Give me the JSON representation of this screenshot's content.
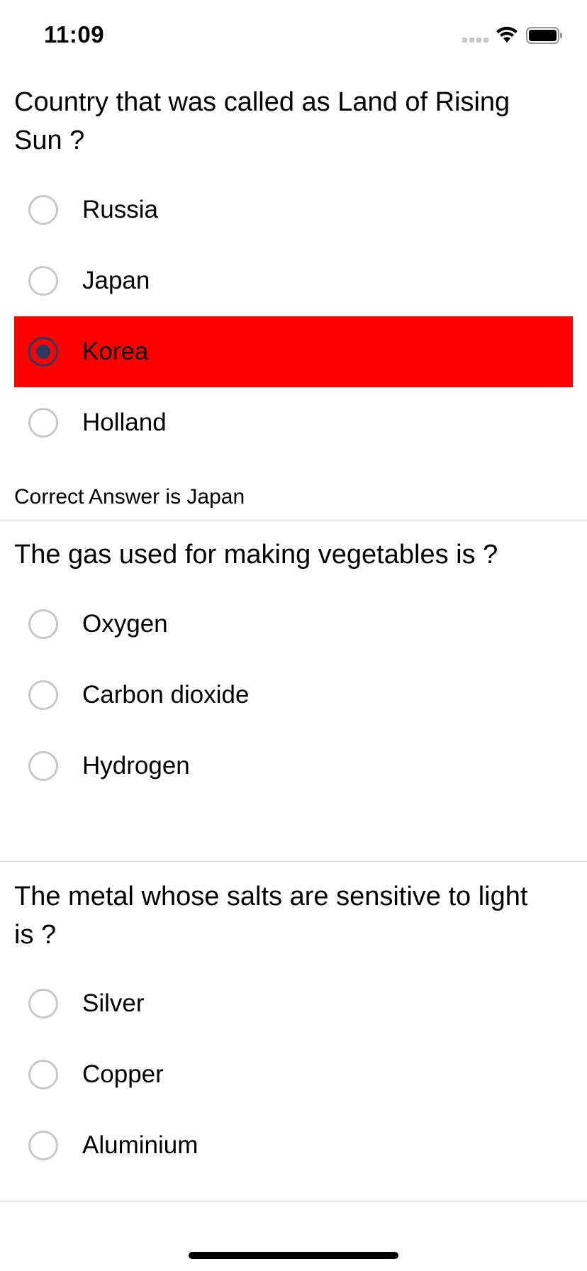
{
  "status_bar": {
    "time": "11:09",
    "icons": [
      "signal-dots-icon",
      "wifi-icon",
      "battery-icon"
    ]
  },
  "questions": [
    {
      "text": "Country that was called as Land of Rising Sun ?",
      "options": [
        {
          "label": "Russia",
          "selected": false
        },
        {
          "label": "Japan",
          "selected": false
        },
        {
          "label": "Korea",
          "selected": true,
          "highlight": "#ff0000"
        },
        {
          "label": "Holland",
          "selected": false
        }
      ],
      "answer_text": "Correct Answer is Japan"
    },
    {
      "text": "The gas used for making vegetables is ?",
      "options": [
        {
          "label": "Oxygen",
          "selected": false
        },
        {
          "label": "Carbon dioxide",
          "selected": false
        },
        {
          "label": "Hydrogen",
          "selected": false
        }
      ]
    },
    {
      "text": "The metal whose salts are sensitive to light is ?",
      "options": [
        {
          "label": "Silver",
          "selected": false
        },
        {
          "label": "Copper",
          "selected": false
        },
        {
          "label": "Aluminium",
          "selected": false
        }
      ]
    }
  ],
  "colors": {
    "wrong_highlight": "#ff0000",
    "radio_border": "#c8c8c8",
    "radio_checked": "#2e3a5c"
  }
}
